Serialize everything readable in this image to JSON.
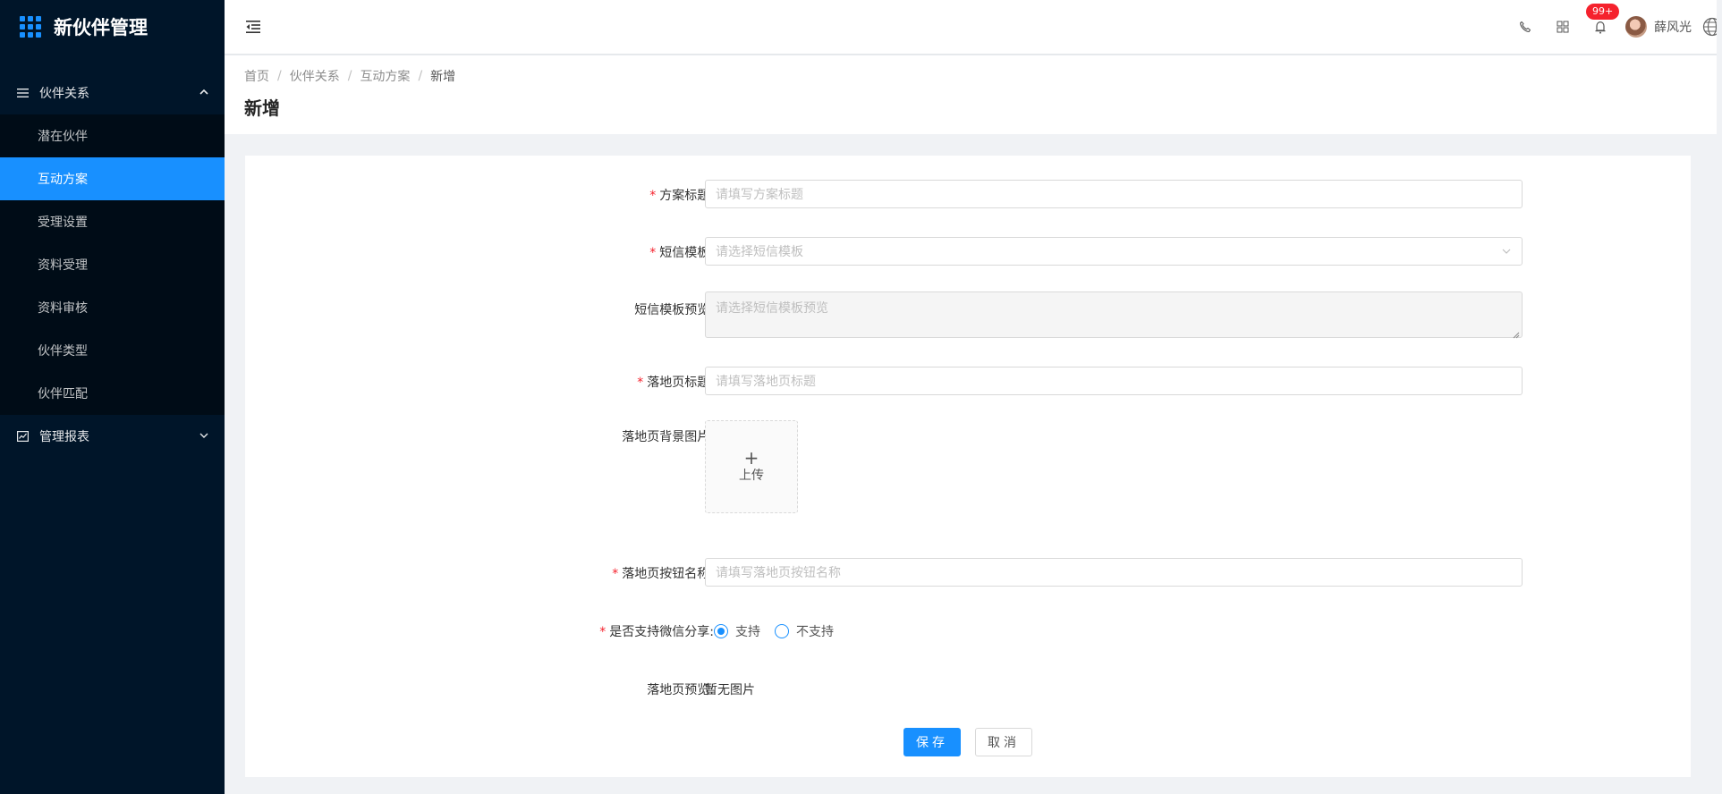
{
  "app": {
    "title": "新伙伴管理"
  },
  "sidebar": {
    "groups": [
      {
        "label": "伙伴关系",
        "icon": "list-icon",
        "expanded": true,
        "items": [
          {
            "label": "潜在伙伴"
          },
          {
            "label": "互动方案",
            "active": true
          },
          {
            "label": "受理设置"
          },
          {
            "label": "资料受理"
          },
          {
            "label": "资料审核"
          },
          {
            "label": "伙伴类型"
          },
          {
            "label": "伙伴匹配"
          }
        ]
      },
      {
        "label": "管理报表",
        "icon": "chart-line-icon",
        "expanded": false
      }
    ]
  },
  "header": {
    "icons": [
      "menu-fold-icon",
      "phone-icon",
      "apps-icon",
      "bell-icon",
      "globe-icon"
    ],
    "notification_badge": "99+",
    "username": "薛风光"
  },
  "breadcrumb": [
    "首页",
    "伙伴关系",
    "互动方案",
    "新增"
  ],
  "page_title": "新增",
  "form": {
    "plan_title": {
      "label": "方案标题:",
      "placeholder": "请填写方案标题",
      "required": true
    },
    "sms_template": {
      "label": "短信模板:",
      "placeholder": "请选择短信模板",
      "required": true
    },
    "sms_preview": {
      "label": "短信模板预览:",
      "placeholder": "请选择短信模板预览",
      "required": false
    },
    "landing_title": {
      "label": "落地页标题:",
      "placeholder": "请填写落地页标题",
      "required": true
    },
    "landing_bg": {
      "label": "落地页背景图片:",
      "upload_label": "上传",
      "required": false
    },
    "landing_button": {
      "label": "落地页按钮名称:",
      "placeholder": "请填写落地页按钮名称",
      "required": true
    },
    "wechat_share": {
      "label": "是否支持微信分享:",
      "required": true,
      "options": [
        {
          "label": "支持",
          "selected": true
        },
        {
          "label": "不支持",
          "selected": false
        }
      ]
    },
    "landing_preview": {
      "label": "落地页预览:",
      "value": "暂无图片"
    },
    "save_label": "保存",
    "cancel_label": "取消"
  },
  "colors": {
    "sidebar_bg": "#001529",
    "accent": "#1890ff",
    "required": "#f5222d"
  }
}
